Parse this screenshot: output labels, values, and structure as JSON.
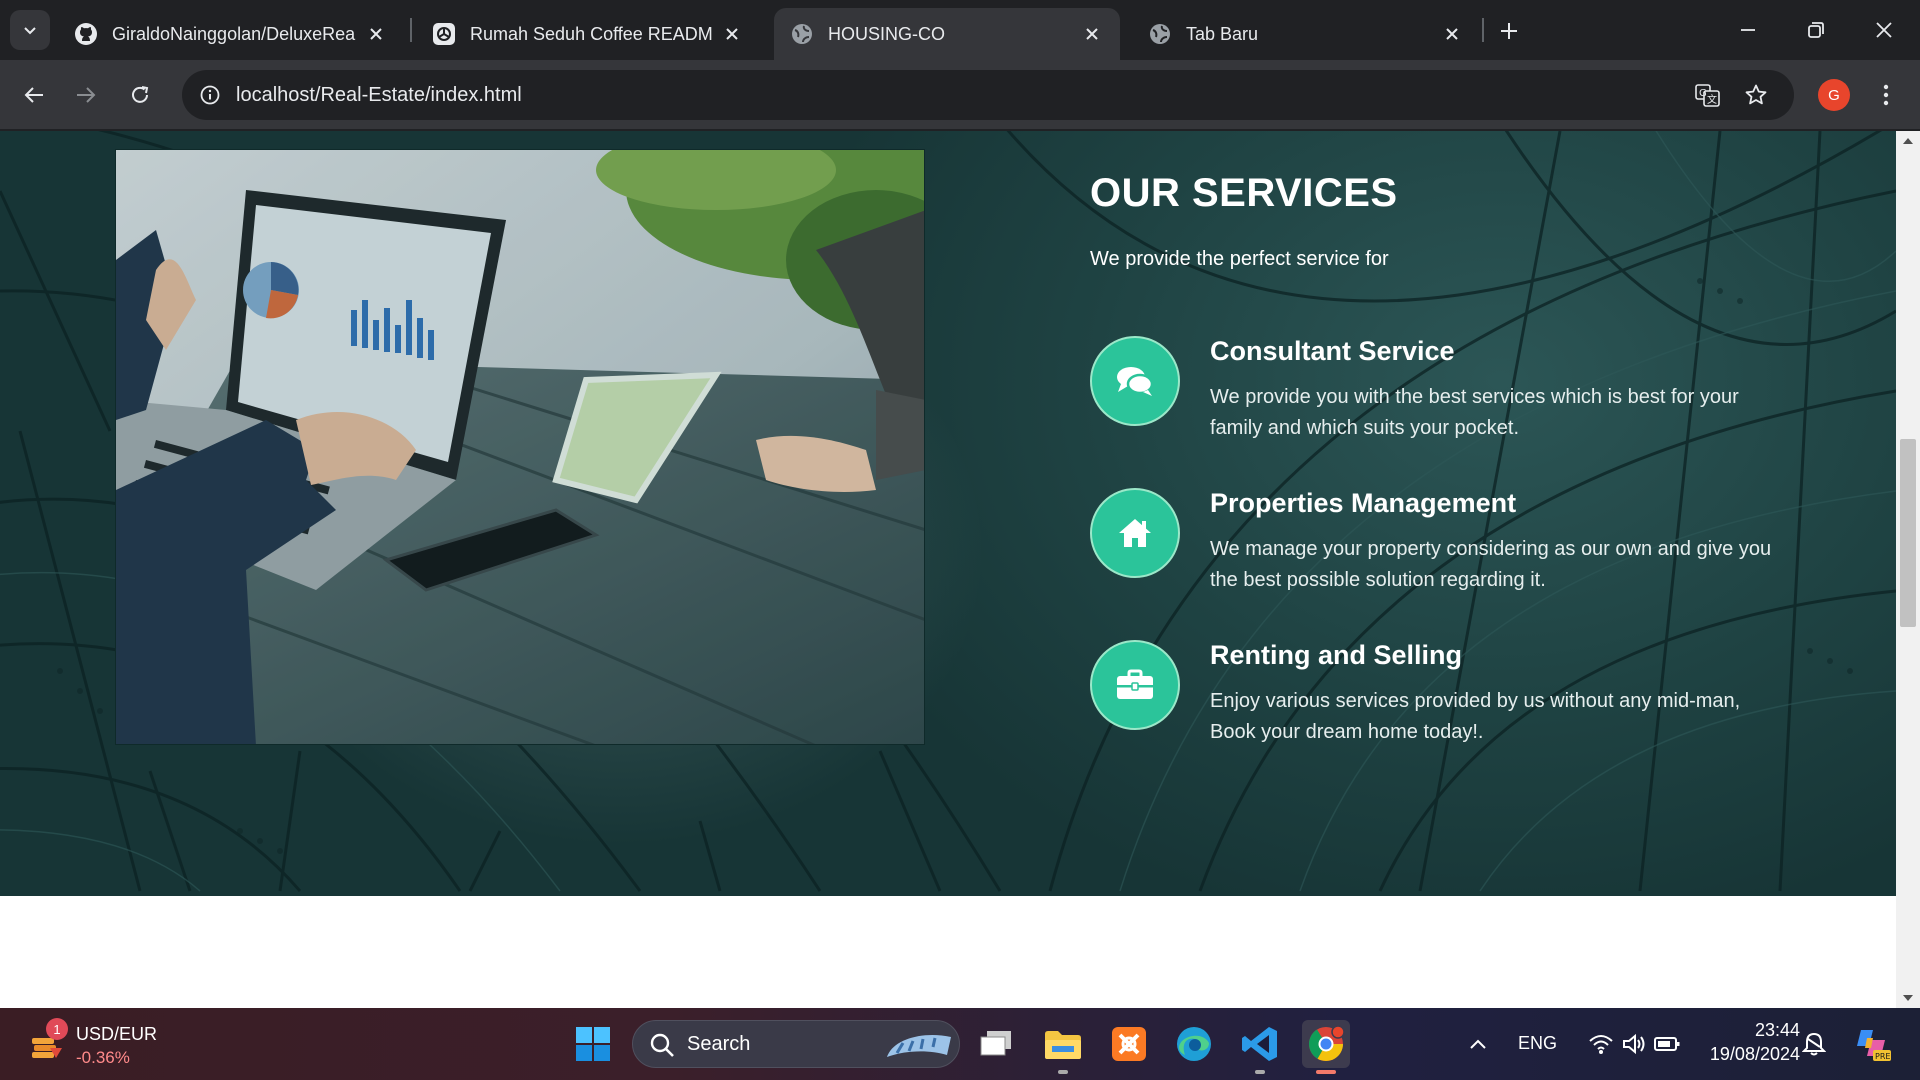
{
  "browser": {
    "tabs": [
      {
        "title": "GiraldoNainggolan/DeluxeReal",
        "icon": "github-icon"
      },
      {
        "title": "Rumah Seduh Coffee README",
        "icon": "chatgpt-icon"
      },
      {
        "title": "HOUSING-CO",
        "icon": "globe-icon",
        "active": true
      },
      {
        "title": "Tab Baru",
        "icon": "globe-icon"
      }
    ],
    "url": "localhost/Real-Estate/index.html",
    "profile_initial": "G"
  },
  "page": {
    "services": {
      "title": "OUR SERVICES",
      "subtitle": "We provide the perfect service for",
      "items": [
        {
          "icon": "chat-bubbles-icon",
          "title": "Consultant Service",
          "desc": "We provide you with the best services which is best for your family and which suits your pocket."
        },
        {
          "icon": "home-icon",
          "title": "Properties Management",
          "desc": "We manage your property considering as our own and give you the best possible solution regarding it."
        },
        {
          "icon": "briefcase-icon",
          "title": "Renting and Selling",
          "desc": "Enjoy various services provided by us without any mid-man, Book your dream home today!."
        }
      ]
    },
    "accent_color": "#2bc49a"
  },
  "taskbar": {
    "widget": {
      "name": "USD/EUR",
      "value": "-0.36%",
      "badge": "1"
    },
    "search_label": "Search",
    "language": "ENG",
    "time": "23:44",
    "date": "19/08/2024"
  }
}
